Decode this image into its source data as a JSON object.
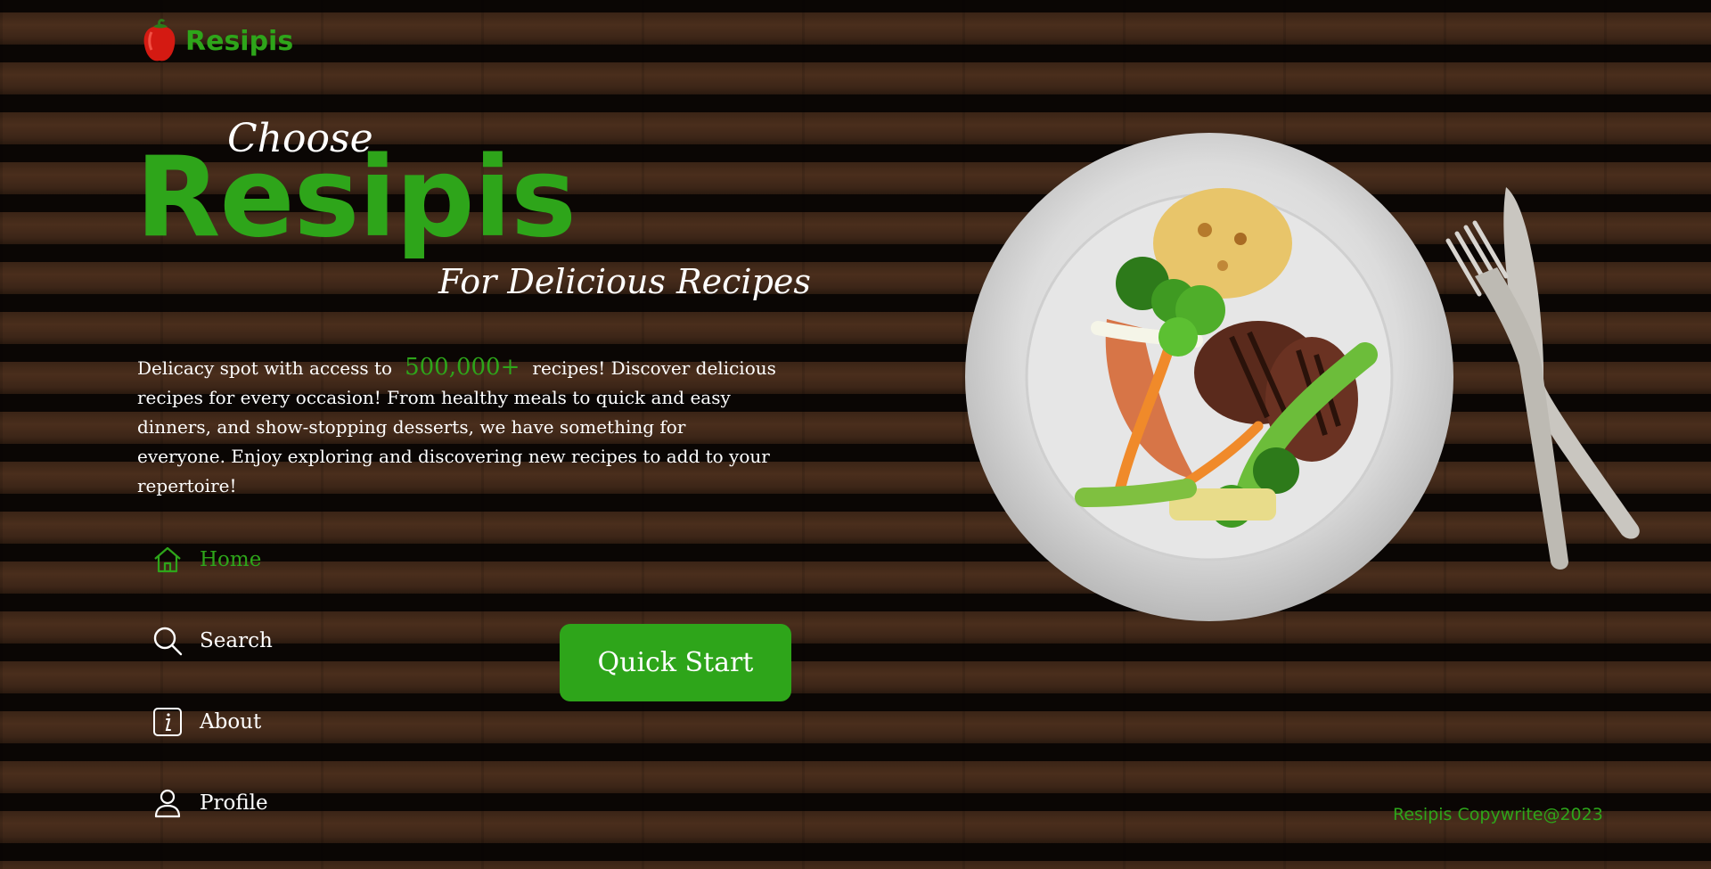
{
  "brand": {
    "name": "Resipis",
    "logo_icon": "bell-pepper-icon",
    "accent_color": "#2ea51a"
  },
  "hero": {
    "choose": "Choose",
    "title": "Resipis",
    "tagline": "For Delicious Recipes",
    "desc_before": "Delicacy spot with access to",
    "count": "500,000+",
    "desc_after": "recipes! Discover delicious recipes for every occasion! From healthy meals to quick and easy dinners, and show-stopping desserts, we have something for everyone. Enjoy exploring and discovering new recipes to add to your repertoire!"
  },
  "nav": {
    "items": [
      {
        "label": "Home",
        "icon": "home-icon",
        "active": true
      },
      {
        "label": "Search",
        "icon": "search-icon"
      },
      {
        "label": "About",
        "icon": "info-icon"
      },
      {
        "label": "Profile",
        "icon": "user-icon"
      }
    ]
  },
  "cta": {
    "label": "Quick Start"
  },
  "footer": {
    "text": "Resipis Copywrite@2023"
  }
}
